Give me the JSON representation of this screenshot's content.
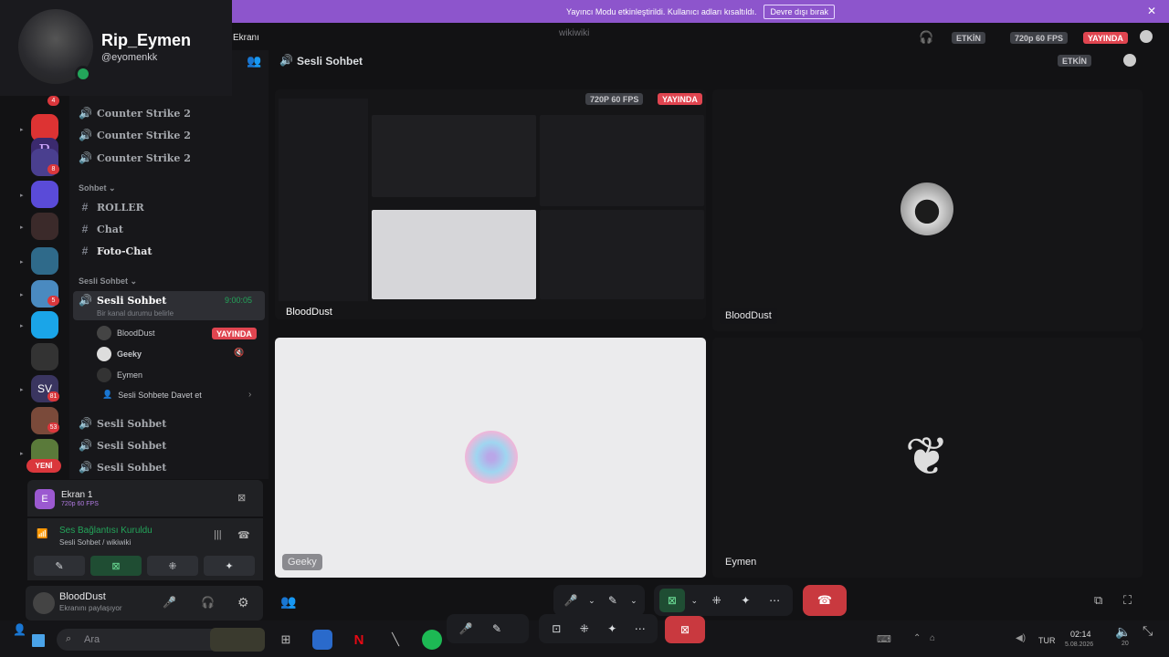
{
  "banner": {
    "text": "Yayıncı Modu etkinleştirildi. Kullanıcı adları kısaltıldı.",
    "button": "Devre dışı bırak",
    "close_icon": "close-icon"
  },
  "profile": {
    "name": "Rip_Eymen",
    "handle": "@eyomenkk"
  },
  "window": {
    "title": "wikiwiki",
    "screen_label": "Ekranı",
    "status": "ETKİN",
    "quality": "720p 60 FPS",
    "live": "YAYINDA"
  },
  "servers": {
    "badges": [
      "4",
      "8",
      "5",
      "81",
      "53"
    ],
    "new_label": "YENİ"
  },
  "channels": {
    "top_voice": [
      "Counter Strike 2",
      "Counter Strike 2",
      "Counter Strike 2"
    ],
    "text_category": "Sohbet",
    "text_channels": [
      "ROLLER",
      "Chat",
      "Foto-Chat"
    ],
    "voice_category": "Sesli Sohbet",
    "active_voice": {
      "name": "Sesli Sohbet",
      "timer": "9:00:05",
      "status_hint": "Bir kanal durumu belirle"
    },
    "members": [
      {
        "name": "BloodDust",
        "badge": "YAYINDA"
      },
      {
        "name": "Geeky",
        "badge": ""
      },
      {
        "name": "Eymen",
        "badge": ""
      }
    ],
    "invite": "Sesli Sohbete Davet et",
    "other_voice": [
      "Sesli Sohbet",
      "Sesli Sohbet",
      "Sesli Sohbet"
    ]
  },
  "stream_card": {
    "title": "Ekran 1",
    "quality": "720p 60 FPS"
  },
  "voice_card": {
    "status": "Ses Bağlantısı Kuruldu",
    "channel": "Sesli Sohbet / wikiwiki"
  },
  "user_card": {
    "name": "BloodDust",
    "status": "Ekranını paylaşıyor"
  },
  "main": {
    "title": "Sesli Sohbet",
    "status": "ETKİN",
    "stream_quality": "720P 60 FPS",
    "stream_live": "YAYINDA",
    "tiles": {
      "stream_owner": "BloodDust",
      "top_right": "BloodDust",
      "bottom_left": "Geeky",
      "bottom_right": "Eymen"
    }
  },
  "taskbar": {
    "search_placeholder": "Ara",
    "lang": "TUR",
    "time": "02:14",
    "date": "5.08.2026",
    "notif": "20"
  }
}
